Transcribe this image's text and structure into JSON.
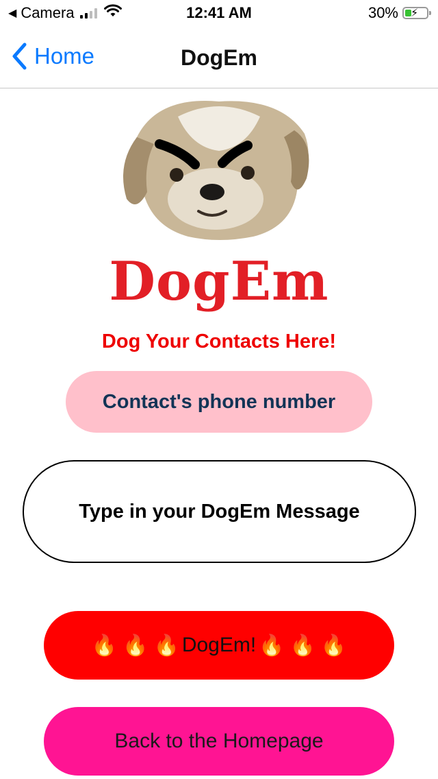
{
  "status_bar": {
    "back_app": "Camera",
    "time": "12:41 AM",
    "battery_percent": "30%",
    "battery_level": 0.3,
    "signal_bars_active": 2,
    "icons": [
      "back-triangle-icon",
      "signal-icon",
      "wifi-icon",
      "battery-charging-icon"
    ]
  },
  "nav": {
    "back_label": "Home",
    "title": "DogEm"
  },
  "logo": {
    "text": "DogEm",
    "brand_color": "#e21f26"
  },
  "main": {
    "tagline": "Dog Your Contacts Here!",
    "phone_placeholder": "Contact's phone number",
    "message_placeholder": "Type in your DogEm Message",
    "dogem_button_label": "DogEm!",
    "dogem_button_icon": "fire-icon",
    "home_button_label": "Back to the Homepage"
  },
  "colors": {
    "accent": "#0a7aff",
    "tagline": "#ee0000",
    "phone_field_bg": "#ffc0cb",
    "dogem_button_bg": "#ff0000",
    "home_button_bg": "#ff1493"
  }
}
